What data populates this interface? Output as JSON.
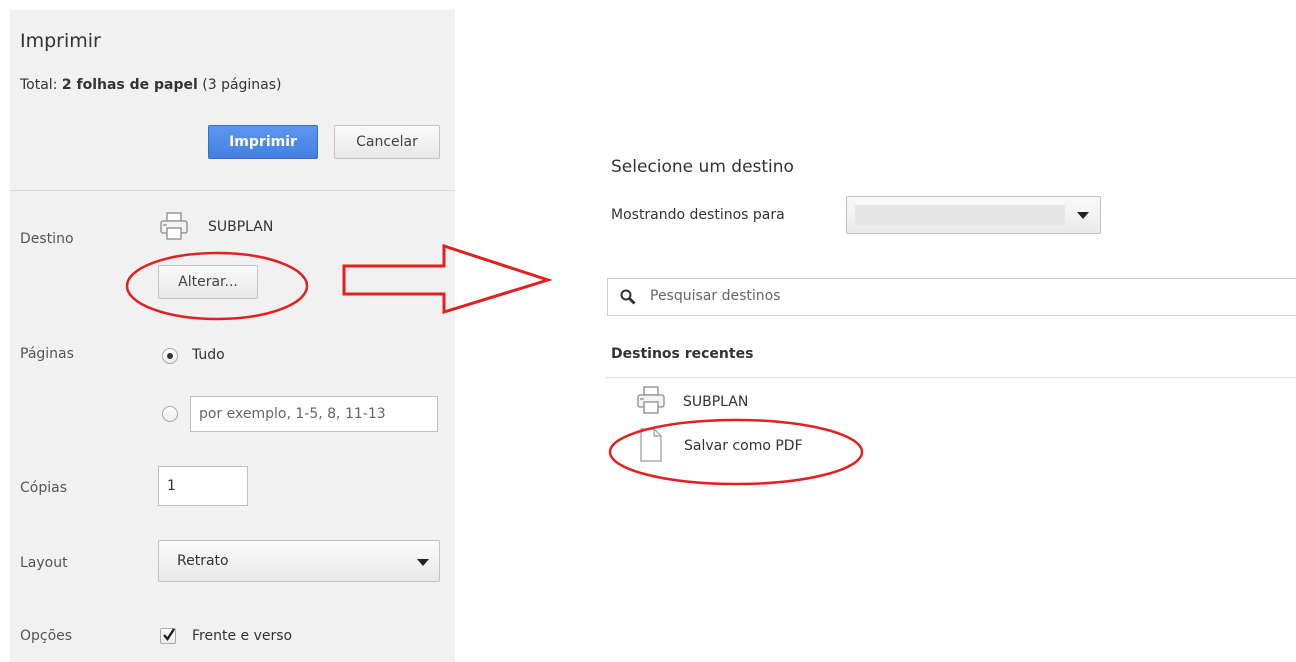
{
  "print_panel": {
    "title": "Imprimir",
    "summary_prefix": "Total: ",
    "summary_bold": "2 folhas de papel",
    "summary_suffix": " (3 páginas)",
    "print_button": "Imprimir",
    "cancel_button": "Cancelar",
    "destination": {
      "label": "Destino",
      "printer_name": "SUBPLAN",
      "change_button": "Alterar..."
    },
    "pages": {
      "label": "Páginas",
      "option_all": "Tudo",
      "all_selected": true,
      "range_placeholder": "por exemplo, 1-5, 8, 11-13"
    },
    "copies": {
      "label": "Cópias",
      "value": "1"
    },
    "layout": {
      "label": "Layout",
      "value": "Retrato"
    },
    "options": {
      "label": "Opções",
      "duplex_label": "Frente e verso",
      "duplex_checked": true
    }
  },
  "destination_dialog": {
    "title": "Selecione um destino",
    "showing_for_label": "Mostrando destinos para",
    "account_value": "",
    "search_placeholder": "Pesquisar destinos",
    "recent_header": "Destinos recentes",
    "recent_destinations": [
      {
        "name": "SUBPLAN",
        "icon": "printer-icon"
      },
      {
        "name": "Salvar como PDF",
        "icon": "pdf-document-icon"
      }
    ]
  },
  "colors": {
    "panel_bg": "#f1f1f1",
    "primary_button": "#4a86e8",
    "annotation_red": "#e32020"
  }
}
